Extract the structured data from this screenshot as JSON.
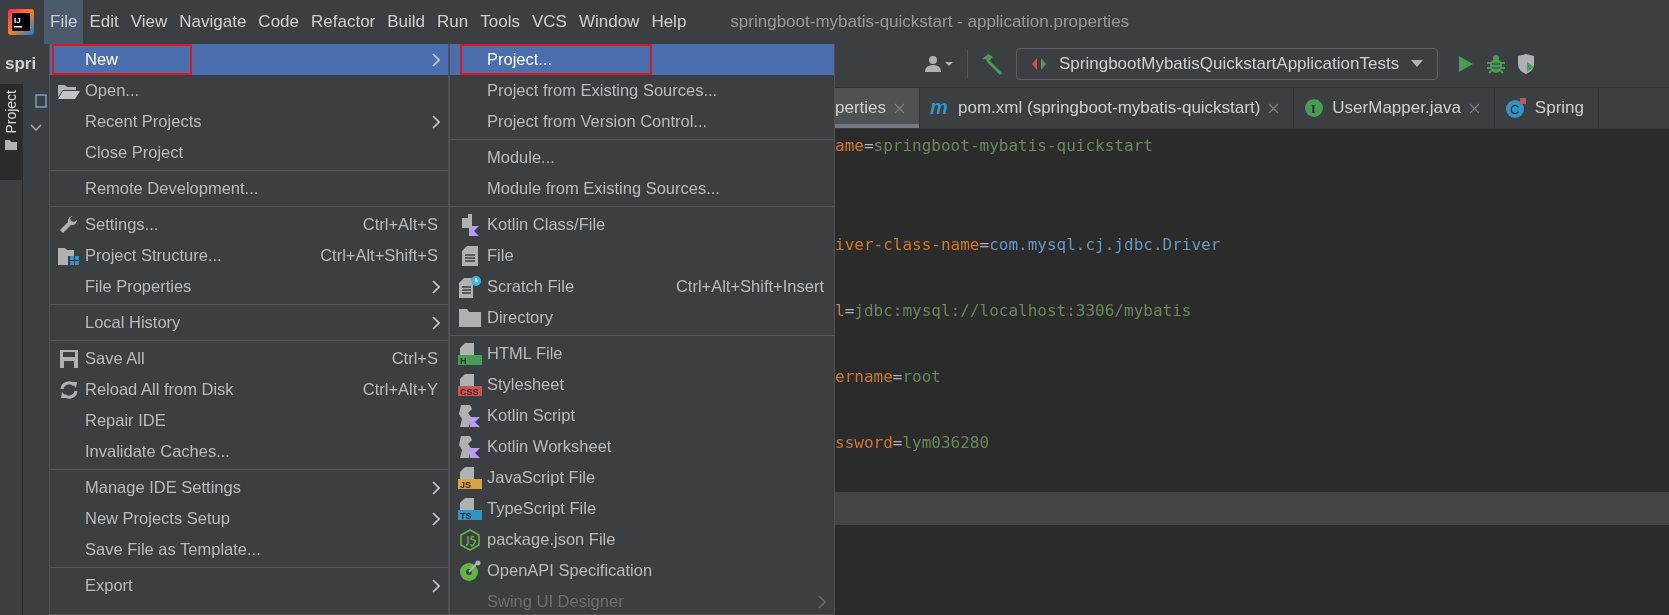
{
  "menubar": {
    "logo": "IJ",
    "items": [
      {
        "label": "File",
        "selected": true
      },
      {
        "label": "Edit",
        "selected": false
      },
      {
        "label": "View",
        "selected": false
      },
      {
        "label": "Navigate",
        "selected": false
      },
      {
        "label": "Code",
        "selected": false
      },
      {
        "label": "Refactor",
        "selected": false
      },
      {
        "label": "Build",
        "selected": false
      },
      {
        "label": "Run",
        "selected": false
      },
      {
        "label": "Tools",
        "selected": false
      },
      {
        "label": "VCS",
        "selected": false
      },
      {
        "label": "Window",
        "selected": false
      },
      {
        "label": "Help",
        "selected": false
      }
    ],
    "title": "springboot-mybatis-quickstart - application.properties"
  },
  "toolbar": {
    "project_name": "spri",
    "run_config": "SpringbootMybatisQuickstartApplicationTests"
  },
  "left_strip": {
    "tool_window": "Project"
  },
  "file_menu": [
    {
      "kind": "item",
      "label": "New",
      "submenu": true,
      "selected": true,
      "highlighted": true
    },
    {
      "kind": "item",
      "label": "Open...",
      "submenu": false,
      "selected": false,
      "highlighted": false
    },
    {
      "kind": "item",
      "label": "Recent Projects",
      "submenu": true,
      "selected": false,
      "highlighted": false
    },
    {
      "kind": "item",
      "label": "Close Project",
      "submenu": false,
      "selected": false,
      "highlighted": false
    },
    {
      "kind": "separator"
    },
    {
      "kind": "item",
      "label": "Remote Development...",
      "submenu": false,
      "selected": false,
      "highlighted": false
    },
    {
      "kind": "separator"
    },
    {
      "kind": "item",
      "label": "Settings...",
      "shortcut": "Ctrl+Alt+S",
      "submenu": false,
      "selected": false,
      "highlighted": false
    },
    {
      "kind": "item",
      "label": "Project Structure...",
      "shortcut": "Ctrl+Alt+Shift+S",
      "submenu": false,
      "selected": false,
      "highlighted": false
    },
    {
      "kind": "item",
      "label": "File Properties",
      "submenu": true,
      "selected": false,
      "highlighted": false
    },
    {
      "kind": "separator"
    },
    {
      "kind": "item",
      "label": "Local History",
      "submenu": true,
      "selected": false,
      "highlighted": false
    },
    {
      "kind": "separator"
    },
    {
      "kind": "item",
      "label": "Save All",
      "shortcut": "Ctrl+S",
      "submenu": false,
      "selected": false,
      "highlighted": false
    },
    {
      "kind": "item",
      "label": "Reload All from Disk",
      "shortcut": "Ctrl+Alt+Y",
      "submenu": false,
      "selected": false,
      "highlighted": false
    },
    {
      "kind": "item",
      "label": "Repair IDE",
      "submenu": false,
      "selected": false,
      "highlighted": false
    },
    {
      "kind": "item",
      "label": "Invalidate Caches...",
      "submenu": false,
      "selected": false,
      "highlighted": false
    },
    {
      "kind": "separator"
    },
    {
      "kind": "item",
      "label": "Manage IDE Settings",
      "submenu": true,
      "selected": false,
      "highlighted": false
    },
    {
      "kind": "item",
      "label": "New Projects Setup",
      "submenu": true,
      "selected": false,
      "highlighted": false
    },
    {
      "kind": "item",
      "label": "Save File as Template...",
      "submenu": false,
      "selected": false,
      "highlighted": false
    },
    {
      "kind": "separator"
    },
    {
      "kind": "item",
      "label": "Export",
      "submenu": true,
      "selected": false,
      "highlighted": false
    }
  ],
  "new_submenu": [
    {
      "kind": "item",
      "label": "Project...",
      "submenu": false,
      "selected": true,
      "highlighted": true,
      "disabled": false
    },
    {
      "kind": "item",
      "label": "Project from Existing Sources...",
      "submenu": false,
      "selected": false,
      "highlighted": false,
      "disabled": false
    },
    {
      "kind": "item",
      "label": "Project from Version Control...",
      "submenu": false,
      "selected": false,
      "highlighted": false,
      "disabled": false
    },
    {
      "kind": "separator"
    },
    {
      "kind": "item",
      "label": "Module...",
      "submenu": false,
      "selected": false,
      "highlighted": false,
      "disabled": false
    },
    {
      "kind": "item",
      "label": "Module from Existing Sources...",
      "submenu": false,
      "selected": false,
      "highlighted": false,
      "disabled": false
    },
    {
      "kind": "separator"
    },
    {
      "kind": "item",
      "label": "Kotlin Class/File",
      "submenu": false,
      "selected": false,
      "highlighted": false,
      "disabled": false
    },
    {
      "kind": "item",
      "label": "File",
      "submenu": false,
      "selected": false,
      "highlighted": false,
      "disabled": false
    },
    {
      "kind": "item",
      "label": "Scratch File",
      "shortcut": "Ctrl+Alt+Shift+Insert",
      "submenu": false,
      "selected": false,
      "highlighted": false,
      "disabled": false
    },
    {
      "kind": "item",
      "label": "Directory",
      "submenu": false,
      "selected": false,
      "highlighted": false,
      "disabled": false
    },
    {
      "kind": "separator"
    },
    {
      "kind": "item",
      "label": "HTML File",
      "badge": "H",
      "color": "#499c54",
      "submenu": false,
      "selected": false,
      "highlighted": false,
      "disabled": false
    },
    {
      "kind": "item",
      "label": "Stylesheet",
      "badge": "CSS",
      "color": "#c75450",
      "submenu": false,
      "selected": false,
      "highlighted": false,
      "disabled": false
    },
    {
      "kind": "item",
      "label": "Kotlin Script",
      "submenu": false,
      "selected": false,
      "highlighted": false,
      "disabled": false
    },
    {
      "kind": "item",
      "label": "Kotlin Worksheet",
      "submenu": false,
      "selected": false,
      "highlighted": false,
      "disabled": false
    },
    {
      "kind": "item",
      "label": "JavaScript File",
      "badge": "JS",
      "color": "#d9a343",
      "submenu": false,
      "selected": false,
      "highlighted": false,
      "disabled": false
    },
    {
      "kind": "item",
      "label": "TypeScript File",
      "badge": "TS",
      "color": "#3592c4",
      "submenu": false,
      "selected": false,
      "highlighted": false,
      "disabled": false
    },
    {
      "kind": "item",
      "label": "package.json File",
      "submenu": false,
      "selected": false,
      "highlighted": false,
      "disabled": false
    },
    {
      "kind": "item",
      "label": "OpenAPI Specification",
      "submenu": false,
      "selected": false,
      "highlighted": false,
      "disabled": false
    },
    {
      "kind": "item",
      "label": "Swing UI Designer",
      "submenu": true,
      "selected": false,
      "highlighted": false,
      "disabled": true
    }
  ],
  "tabs": [
    {
      "label": "perties",
      "selected": true,
      "closable": true
    },
    {
      "label": "pom.xml (springboot-mybatis-quickstart)",
      "badge": "m",
      "selected": false,
      "closable": true
    },
    {
      "label": "UserMapper.java",
      "badge": "I",
      "selected": false,
      "closable": true
    },
    {
      "label": "Spring",
      "badge": "C",
      "selected": false,
      "closable": false
    }
  ],
  "editor_lines": [
    {
      "key": "ame",
      "operator": "=",
      "value": "springboot-mybatis-quickstart",
      "kind": "string",
      "current": false
    },
    {
      "current": false
    },
    {
      "current": false
    },
    {
      "key": "iver-class-name",
      "operator": "=",
      "value": "com.mysql.cj.jdbc.Driver",
      "kind": "class",
      "current": false
    },
    {
      "current": false
    },
    {
      "key": "l",
      "operator": "=",
      "value": "jdbc:mysql://localhost:3306/mybatis",
      "kind": "string",
      "current": false
    },
    {
      "current": false
    },
    {
      "key": "ername",
      "operator": "=",
      "value": "root",
      "kind": "string",
      "current": false
    },
    {
      "current": false
    },
    {
      "key": "ssword",
      "operator": "=",
      "value": "lym036280",
      "kind": "string",
      "current": false
    },
    {
      "current": false
    },
    {
      "current": true
    }
  ]
}
